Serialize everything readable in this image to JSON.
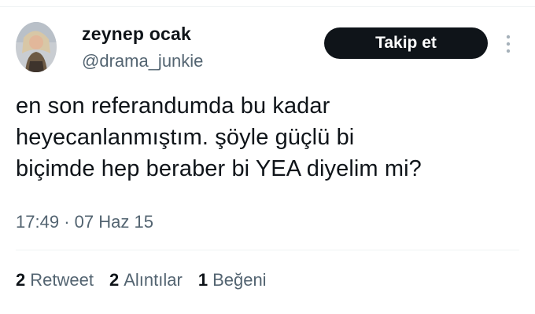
{
  "user": {
    "display_name": "zeynep ocak",
    "handle": "@drama_junkie"
  },
  "follow_label": "Takip et",
  "more_icon": "more-dots-icon",
  "tweet": {
    "lines": [
      "en son referandumda bu kadar",
      "heyecanlanmıştım. şöyle güçlü bi",
      "biçimde hep beraber bi YEA diyelim mi?"
    ]
  },
  "meta": {
    "time": "17:49",
    "separator": "·",
    "date": "07 Haz 15"
  },
  "stats": {
    "retweets_count": "2",
    "retweets_label": "Retweet",
    "quotes_count": "2",
    "quotes_label": "Alıntılar",
    "likes_count": "1",
    "likes_label": "Beğeni"
  },
  "colors": {
    "text": "#0f1419",
    "secondary": "#536471",
    "button_bg": "#0f1419",
    "divider": "#eff3f4"
  }
}
